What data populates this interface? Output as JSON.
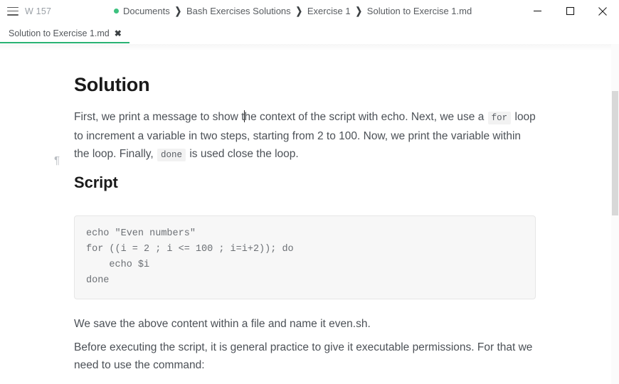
{
  "titlebar": {
    "menu_icon": "hamburger-icon",
    "word_count": "W 157",
    "breadcrumb": {
      "status_dot_color": "#3dc17f",
      "separator": "❯",
      "items": [
        "Documents",
        "Bash Exercises Solutions",
        "Exercise 1",
        "Solution to Exercise 1.md"
      ]
    },
    "window_controls": {
      "minimize": "minimize-icon",
      "maximize": "maximize-icon",
      "close": "close-icon"
    }
  },
  "tabs": [
    {
      "label": "Solution to Exercise 1.md",
      "close_label": "✖",
      "active": true,
      "accent_color": "#28b273"
    }
  ],
  "document": {
    "pilcrow": "¶",
    "heading_1": "Solution",
    "heading_2": "Script",
    "paragraph_1": {
      "part_1": "First, we print a message to show t",
      "part_2": "he context of the script with echo. Next, we use a ",
      "code_1": "for",
      "part_3": " loop to increment a variable in two steps, starting from 2 to 100. Now, we print the variable within the loop. Finally, ",
      "code_2": "done",
      "part_4": " is used close the loop."
    },
    "code_block": "echo \"Even numbers\"\nfor ((i = 2 ; i <= 100 ; i=i+2)); do\n    echo $i\ndone",
    "paragraph_2": "We save the above content within a file and name it even.sh.",
    "paragraph_3": "Before executing the script, it is general practice to give it executable permissions. For that we need to use the command:"
  },
  "scrollbar": {
    "thumb_color": "#d8d8d8",
    "track_color": "#fbfbfb"
  }
}
